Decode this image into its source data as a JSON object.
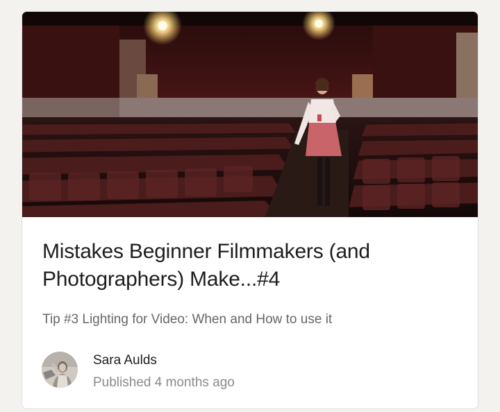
{
  "article": {
    "title": "Mistakes Beginner Filmmakers (and Photographers) Make...#4",
    "subtitle": "Tip #3 Lighting for Video: When and How to use it",
    "author_name": "Sara Aulds",
    "published_label": "Published",
    "published_time": "4 months ago"
  }
}
